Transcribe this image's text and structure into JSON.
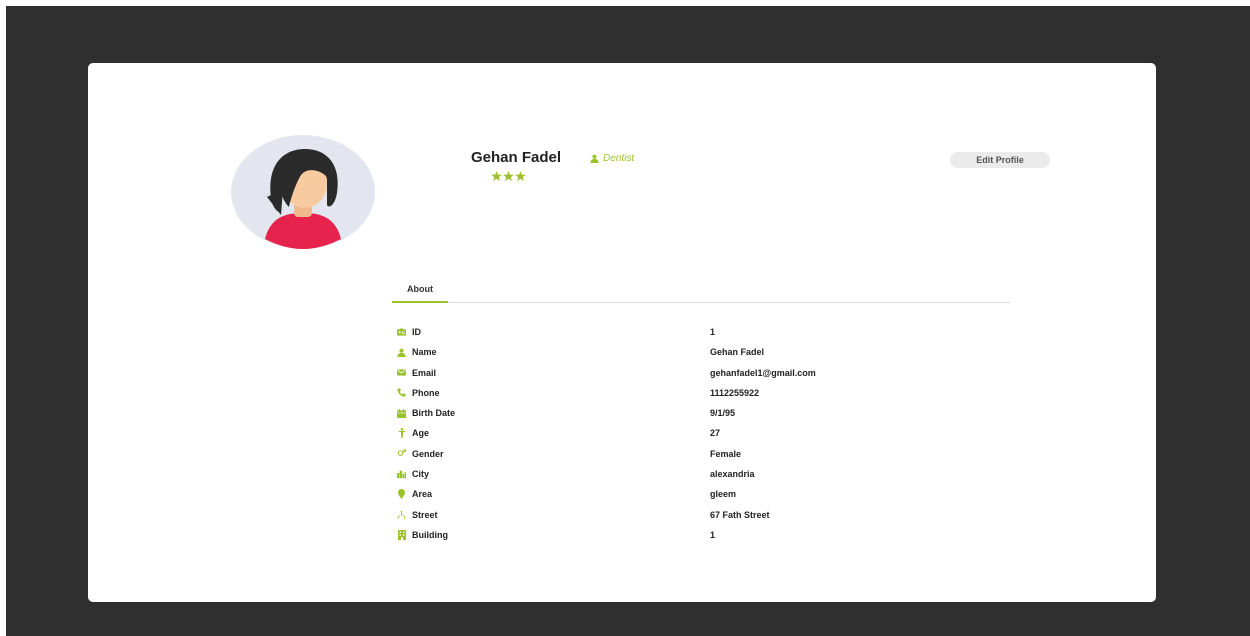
{
  "profile": {
    "name": "Gehan Fadel",
    "role": "Dentist",
    "rating": 3,
    "edit_label": "Edit Profile"
  },
  "tabs": [
    {
      "label": "About",
      "active": true
    }
  ],
  "details": [
    {
      "icon": "id-card-icon",
      "label": "ID",
      "value": "1"
    },
    {
      "icon": "user-icon",
      "label": "Name",
      "value": "Gehan Fadel"
    },
    {
      "icon": "envelope-icon",
      "label": "Email",
      "value": "gehanfadel1@gmail.com"
    },
    {
      "icon": "phone-icon",
      "label": "Phone",
      "value": "1112255922"
    },
    {
      "icon": "calendar-icon",
      "label": "Birth Date",
      "value": "9/1/95"
    },
    {
      "icon": "child-icon",
      "label": "Age",
      "value": "27"
    },
    {
      "icon": "venus-icon",
      "label": "Gender",
      "value": "Female"
    },
    {
      "icon": "city-icon",
      "label": "City",
      "value": "alexandria"
    },
    {
      "icon": "map-pin-icon",
      "label": "Area",
      "value": "gleem"
    },
    {
      "icon": "road-icon",
      "label": "Street",
      "value": "67 Fath Street"
    },
    {
      "icon": "building-icon",
      "label": "Building",
      "value": "1"
    }
  ],
  "colors": {
    "accent": "#9bc22b",
    "backdrop": "#2f2f2f",
    "card": "#ffffff",
    "avatar_bg": "#e3e5ef",
    "avatar_shirt": "#e5234c",
    "avatar_hair": "#2b2b2b",
    "avatar_skin": "#f8caa0"
  }
}
